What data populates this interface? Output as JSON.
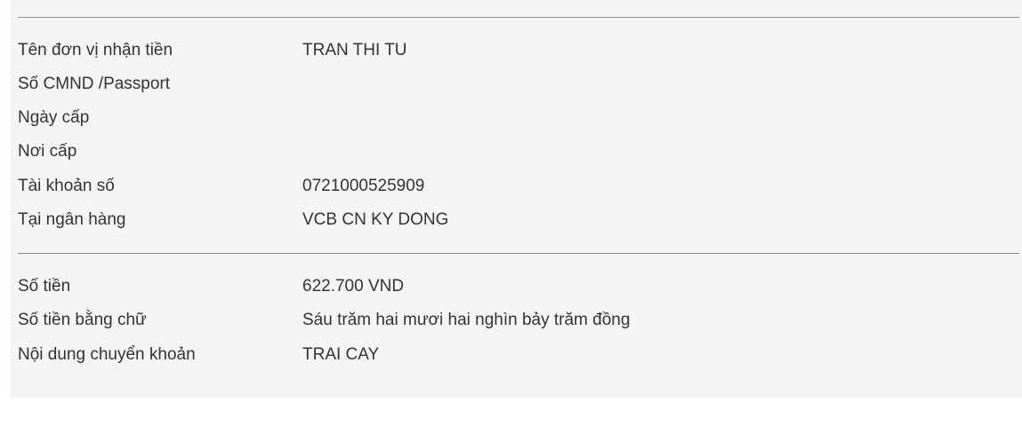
{
  "recipient_section": [
    {
      "label": "Tên đơn vị nhận tiền",
      "value": "TRAN THI TU"
    },
    {
      "label": "Số CMND /Passport",
      "value": ""
    },
    {
      "label": "Ngày cấp",
      "value": ""
    },
    {
      "label": "Nơi cấp",
      "value": ""
    },
    {
      "label": "Tài khoản số",
      "value": "0721000525909"
    },
    {
      "label": "Tại ngân hàng",
      "value": "VCB CN KY DONG"
    }
  ],
  "amount_section": [
    {
      "label": "Số tiền",
      "value": "622.700 VND"
    },
    {
      "label": "Số tiền bằng chữ",
      "value": "Sáu trăm hai mươi hai nghìn bảy trăm đồng"
    },
    {
      "label": "Nội dung chuyển khoản",
      "value": "TRAI CAY"
    }
  ]
}
